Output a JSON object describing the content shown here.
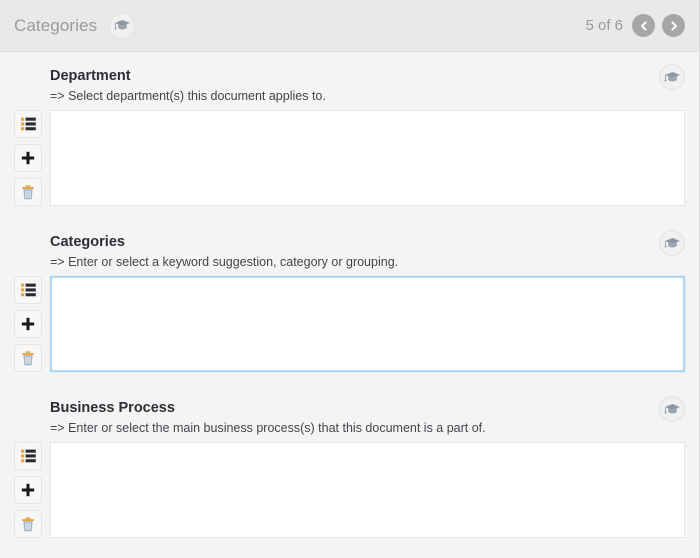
{
  "header": {
    "title": "Categories",
    "help_icon": "graduation-cap-icon",
    "pager": {
      "count_label": "5 of 6",
      "prev_icon": "chevron-left-icon",
      "next_icon": "chevron-right-icon"
    }
  },
  "colors": {
    "header_bg": "#e9e9e9",
    "body_bg": "#f4f4f4",
    "input_bg": "#ffffff",
    "focus_border": "#b3d9f2",
    "nav_button": "#a6a6a6",
    "title_text": "#9a9a9a",
    "label_text": "#2e2e38",
    "trash_accent": "#e8a33d",
    "list_accent": "#e8a33d"
  },
  "tools": {
    "list_label": "list-picker",
    "add_label": "add",
    "delete_label": "delete",
    "list_icon": "list-icon",
    "add_icon": "plus-icon",
    "delete_icon": "trash-icon"
  },
  "sections": [
    {
      "label": "Department",
      "hint": "=> Select department(s) this document applies to.",
      "value": "",
      "focused": false,
      "help_icon": "graduation-cap-icon"
    },
    {
      "label": "Categories",
      "hint": "=> Enter or select a keyword suggestion, category or grouping.",
      "value": "",
      "focused": true,
      "help_icon": "graduation-cap-icon"
    },
    {
      "label": "Business Process",
      "hint": "=> Enter or select the main business process(s) that this document is a part of.",
      "value": "",
      "focused": false,
      "help_icon": "graduation-cap-icon"
    }
  ]
}
